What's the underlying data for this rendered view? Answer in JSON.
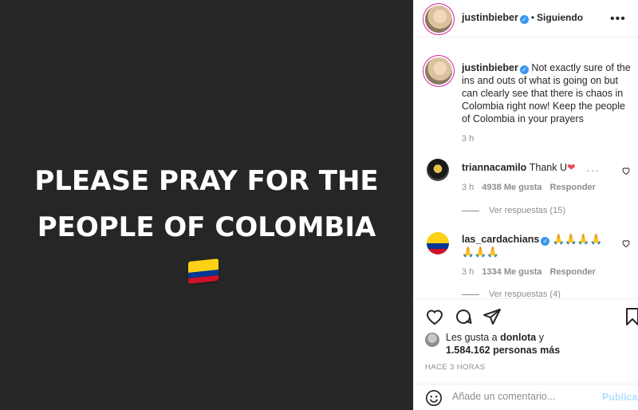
{
  "post": {
    "image_text_line1": "PLEASE PRAY FOR THE",
    "image_text_line2": "PEOPLE OF COLOMBIA",
    "flag_icon": "colombia-flag-emoji"
  },
  "header": {
    "username": "justinbieber",
    "separator": "•",
    "follow_status": "Siguiendo",
    "verified_icon": "verified-badge-icon"
  },
  "caption": {
    "username": "justinbieber",
    "text": "Not exactly sure of the ins and outs of what is going on but can clearly see that there is chaos in Colombia right now! Keep the people of Colombia in your prayers",
    "time": "3 h"
  },
  "comments": [
    {
      "username": "triannacamilo",
      "text": "Thank U",
      "emoji": "❤",
      "time": "3 h",
      "likes": "4938 Me gusta",
      "reply": "Responder",
      "view_replies": "Ver respuestas (15)"
    },
    {
      "username": "las_cardachians",
      "text": "🙏🙏🙏🙏",
      "text2": "🙏🙏🙏",
      "time": "3 h",
      "likes": "1334 Me gusta",
      "reply": "Responder",
      "view_replies": "Ver respuestas (4)"
    }
  ],
  "likes": {
    "prefix": "Les gusta a",
    "user": "donlota",
    "connector": "y",
    "count": "1.584.162 personas más"
  },
  "timestamp": "HACE 3 HORAS",
  "add_comment": {
    "placeholder": "Añade un comentario...",
    "publish": "Publicar"
  },
  "colors": {
    "media_bg": "#262626",
    "verified": "#3897f0",
    "heart_red": "#ed4956",
    "publish_disabled": "#b2dffc",
    "muted": "#8e8e8e"
  }
}
